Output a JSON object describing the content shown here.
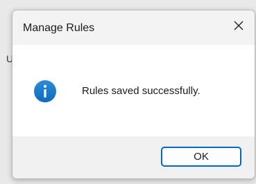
{
  "background": {
    "partial_text": "U"
  },
  "dialog": {
    "title": "Manage Rules",
    "close_glyph": "✕",
    "icon": "info-icon",
    "message": "Rules saved successfully.",
    "ok_label": "OK"
  },
  "colors": {
    "accent": "#0067c0",
    "info_icon": "#1979ca",
    "titlebar": "#f3f3f3",
    "footer": "#f0f0f0"
  }
}
